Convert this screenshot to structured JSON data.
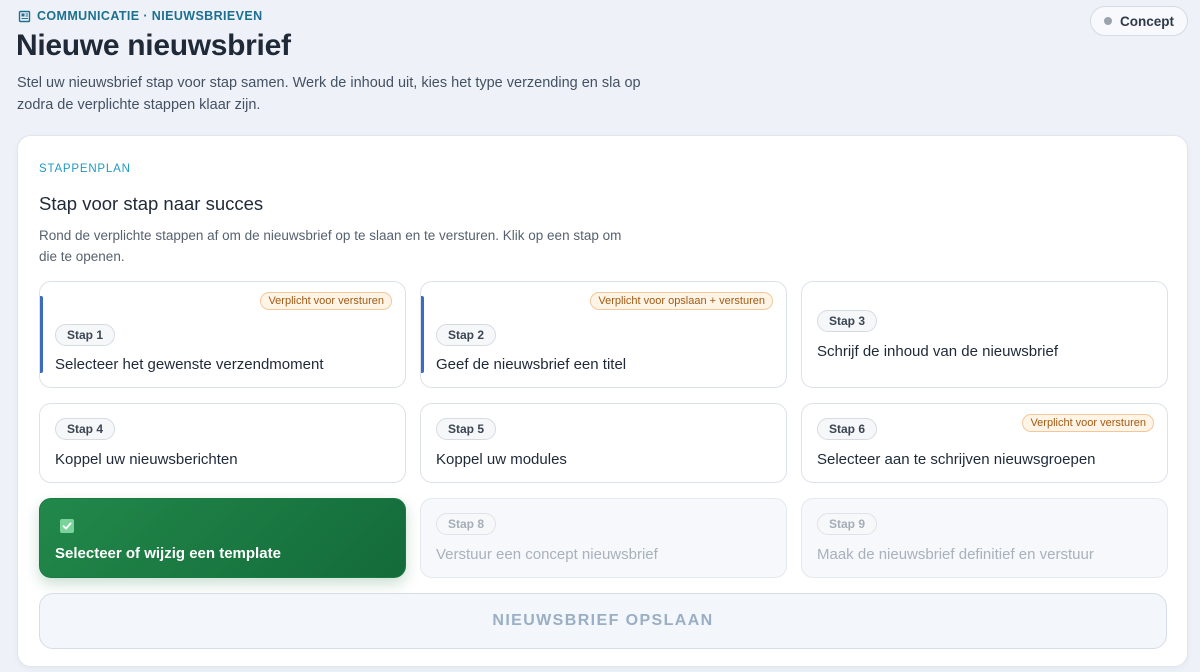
{
  "header": {
    "breadcrumb": "Communicatie · Nieuwsbrieven",
    "title": "Nieuwe nieuwsbrief",
    "description": "Stel uw nieuwsbrief stap voor stap samen. Werk de inhoud uit, kies het type verzending en sla op zodra de verplichte stappen klaar zijn.",
    "status": "Concept",
    "breadcrumb_icon": "newspaper-icon"
  },
  "card": {
    "eyebrow": "Stappenplan",
    "title": "Stap voor stap naar succes",
    "description": "Rond de verplichte stappen af om de nieuwsbrief op te slaan en te versturen. Klik op een stap om die te openen."
  },
  "steps": [
    {
      "badge": "Stap 1",
      "label": "Selecteer het gewenste verzendmoment",
      "required": "Verplicht voor versturen",
      "state": "open"
    },
    {
      "badge": "Stap 2",
      "label": "Geef de nieuwsbrief een titel",
      "required": "Verplicht voor opslaan + versturen",
      "state": "open"
    },
    {
      "badge": "Stap 3",
      "label": "Schrijf de inhoud van de nieuwsbrief",
      "required": "",
      "state": "open"
    },
    {
      "badge": "Stap 4",
      "label": "Koppel uw nieuwsberichten",
      "required": "",
      "state": "open"
    },
    {
      "badge": "Stap 5",
      "label": "Koppel uw modules",
      "required": "",
      "state": "open"
    },
    {
      "badge": "Stap 6",
      "label": "Selecteer aan te schrijven nieuwsgroepen",
      "required": "Verplicht voor versturen",
      "state": "open"
    },
    {
      "badge": "",
      "label": "Selecteer of wijzig een template",
      "required": "",
      "state": "done"
    },
    {
      "badge": "Stap 8",
      "label": "Verstuur een concept nieuwsbrief",
      "required": "",
      "state": "disabled"
    },
    {
      "badge": "Stap 9",
      "label": "Maak de nieuwsbrief definitief en verstuur",
      "required": "",
      "state": "disabled"
    }
  ],
  "save_button": "Nieuwsbrief opslaan",
  "colors": {
    "accent": "#1d6f8f",
    "done": "#1e7d44",
    "required_bg": "#fff4e6",
    "required_text": "#a25a12"
  }
}
